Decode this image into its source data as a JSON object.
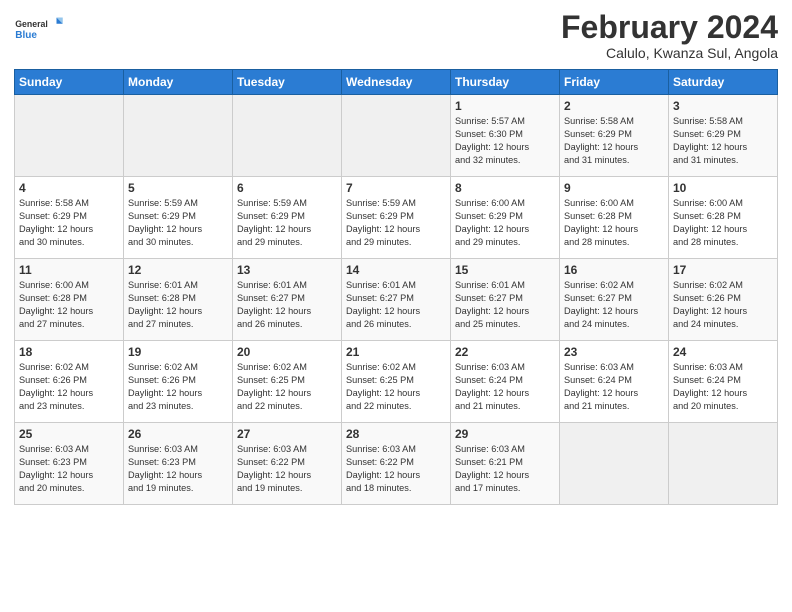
{
  "header": {
    "logo_line1": "General",
    "logo_line2": "Blue",
    "month_title": "February 2024",
    "location": "Calulo, Kwanza Sul, Angola"
  },
  "days_of_week": [
    "Sunday",
    "Monday",
    "Tuesday",
    "Wednesday",
    "Thursday",
    "Friday",
    "Saturday"
  ],
  "weeks": [
    [
      {
        "day": "",
        "info": ""
      },
      {
        "day": "",
        "info": ""
      },
      {
        "day": "",
        "info": ""
      },
      {
        "day": "",
        "info": ""
      },
      {
        "day": "1",
        "info": "Sunrise: 5:57 AM\nSunset: 6:30 PM\nDaylight: 12 hours\nand 32 minutes."
      },
      {
        "day": "2",
        "info": "Sunrise: 5:58 AM\nSunset: 6:29 PM\nDaylight: 12 hours\nand 31 minutes."
      },
      {
        "day": "3",
        "info": "Sunrise: 5:58 AM\nSunset: 6:29 PM\nDaylight: 12 hours\nand 31 minutes."
      }
    ],
    [
      {
        "day": "4",
        "info": "Sunrise: 5:58 AM\nSunset: 6:29 PM\nDaylight: 12 hours\nand 30 minutes."
      },
      {
        "day": "5",
        "info": "Sunrise: 5:59 AM\nSunset: 6:29 PM\nDaylight: 12 hours\nand 30 minutes."
      },
      {
        "day": "6",
        "info": "Sunrise: 5:59 AM\nSunset: 6:29 PM\nDaylight: 12 hours\nand 29 minutes."
      },
      {
        "day": "7",
        "info": "Sunrise: 5:59 AM\nSunset: 6:29 PM\nDaylight: 12 hours\nand 29 minutes."
      },
      {
        "day": "8",
        "info": "Sunrise: 6:00 AM\nSunset: 6:29 PM\nDaylight: 12 hours\nand 29 minutes."
      },
      {
        "day": "9",
        "info": "Sunrise: 6:00 AM\nSunset: 6:28 PM\nDaylight: 12 hours\nand 28 minutes."
      },
      {
        "day": "10",
        "info": "Sunrise: 6:00 AM\nSunset: 6:28 PM\nDaylight: 12 hours\nand 28 minutes."
      }
    ],
    [
      {
        "day": "11",
        "info": "Sunrise: 6:00 AM\nSunset: 6:28 PM\nDaylight: 12 hours\nand 27 minutes."
      },
      {
        "day": "12",
        "info": "Sunrise: 6:01 AM\nSunset: 6:28 PM\nDaylight: 12 hours\nand 27 minutes."
      },
      {
        "day": "13",
        "info": "Sunrise: 6:01 AM\nSunset: 6:27 PM\nDaylight: 12 hours\nand 26 minutes."
      },
      {
        "day": "14",
        "info": "Sunrise: 6:01 AM\nSunset: 6:27 PM\nDaylight: 12 hours\nand 26 minutes."
      },
      {
        "day": "15",
        "info": "Sunrise: 6:01 AM\nSunset: 6:27 PM\nDaylight: 12 hours\nand 25 minutes."
      },
      {
        "day": "16",
        "info": "Sunrise: 6:02 AM\nSunset: 6:27 PM\nDaylight: 12 hours\nand 24 minutes."
      },
      {
        "day": "17",
        "info": "Sunrise: 6:02 AM\nSunset: 6:26 PM\nDaylight: 12 hours\nand 24 minutes."
      }
    ],
    [
      {
        "day": "18",
        "info": "Sunrise: 6:02 AM\nSunset: 6:26 PM\nDaylight: 12 hours\nand 23 minutes."
      },
      {
        "day": "19",
        "info": "Sunrise: 6:02 AM\nSunset: 6:26 PM\nDaylight: 12 hours\nand 23 minutes."
      },
      {
        "day": "20",
        "info": "Sunrise: 6:02 AM\nSunset: 6:25 PM\nDaylight: 12 hours\nand 22 minutes."
      },
      {
        "day": "21",
        "info": "Sunrise: 6:02 AM\nSunset: 6:25 PM\nDaylight: 12 hours\nand 22 minutes."
      },
      {
        "day": "22",
        "info": "Sunrise: 6:03 AM\nSunset: 6:24 PM\nDaylight: 12 hours\nand 21 minutes."
      },
      {
        "day": "23",
        "info": "Sunrise: 6:03 AM\nSunset: 6:24 PM\nDaylight: 12 hours\nand 21 minutes."
      },
      {
        "day": "24",
        "info": "Sunrise: 6:03 AM\nSunset: 6:24 PM\nDaylight: 12 hours\nand 20 minutes."
      }
    ],
    [
      {
        "day": "25",
        "info": "Sunrise: 6:03 AM\nSunset: 6:23 PM\nDaylight: 12 hours\nand 20 minutes."
      },
      {
        "day": "26",
        "info": "Sunrise: 6:03 AM\nSunset: 6:23 PM\nDaylight: 12 hours\nand 19 minutes."
      },
      {
        "day": "27",
        "info": "Sunrise: 6:03 AM\nSunset: 6:22 PM\nDaylight: 12 hours\nand 19 minutes."
      },
      {
        "day": "28",
        "info": "Sunrise: 6:03 AM\nSunset: 6:22 PM\nDaylight: 12 hours\nand 18 minutes."
      },
      {
        "day": "29",
        "info": "Sunrise: 6:03 AM\nSunset: 6:21 PM\nDaylight: 12 hours\nand 17 minutes."
      },
      {
        "day": "",
        "info": ""
      },
      {
        "day": "",
        "info": ""
      }
    ]
  ]
}
